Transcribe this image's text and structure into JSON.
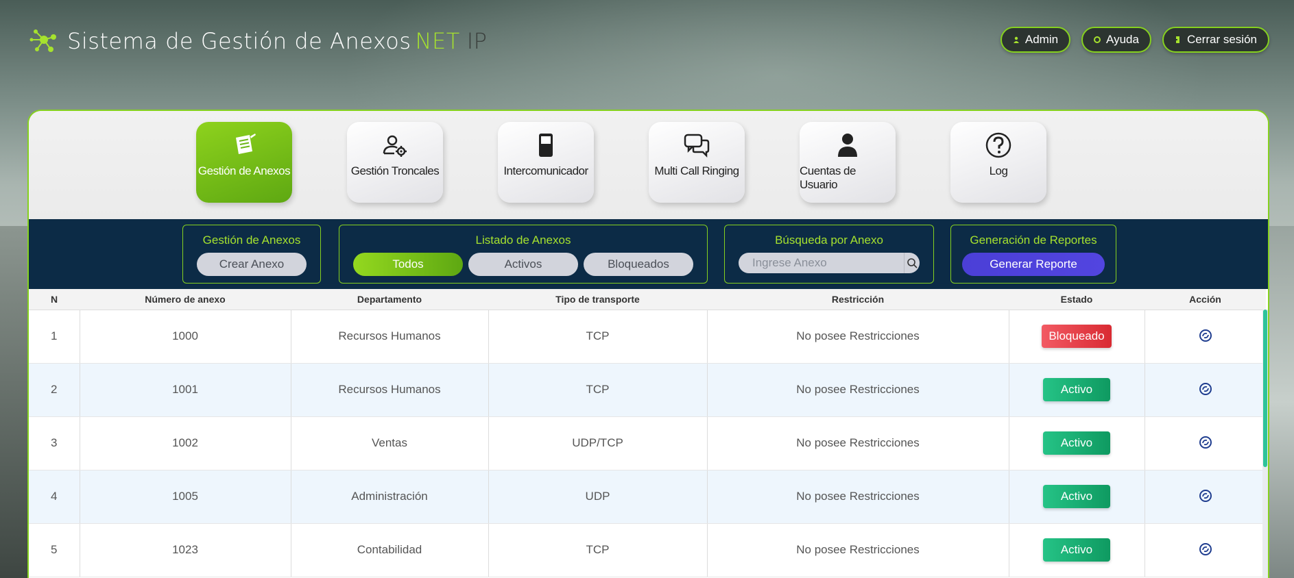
{
  "app": {
    "title": "Sistema de Gestión de Anexos",
    "title_net": "NET",
    "title_ip": "IP"
  },
  "top_actions": {
    "admin": "Admin",
    "help": "Ayuda",
    "logout": "Cerrar sesión"
  },
  "nav": {
    "items": [
      {
        "label": "Gestión de Anexos",
        "icon": "notepad-icon",
        "active": true
      },
      {
        "label": "Gestión Troncales",
        "icon": "user-gear-icon",
        "active": false
      },
      {
        "label": "Intercomunicador",
        "icon": "intercom-icon",
        "active": false
      },
      {
        "label": "Multi Call Ringing",
        "icon": "chat-bubbles-icon",
        "active": false
      },
      {
        "label": "Cuentas de Usuario",
        "icon": "user-icon",
        "active": false
      },
      {
        "label": "Log",
        "icon": "question-circle-icon",
        "active": false
      }
    ]
  },
  "toolbar": {
    "gestion": {
      "title": "Gestión de Anexos",
      "create_label": "Crear Anexo"
    },
    "listado": {
      "title": "Listado de Anexos",
      "filters": [
        "Todos",
        "Activos",
        "Bloqueados"
      ],
      "selected": "Todos"
    },
    "busqueda": {
      "title": "Búsqueda por Anexo",
      "placeholder": "Ingrese Anexo",
      "value": ""
    },
    "reportes": {
      "title": "Generación de Reportes",
      "button_label": "Generar Reporte"
    }
  },
  "table": {
    "columns": [
      "N",
      "Número de anexo",
      "Departamento",
      "Tipo de transporte",
      "Restricción",
      "Estado",
      "Acción"
    ],
    "rows": [
      {
        "n": "1",
        "number": "1000",
        "department": "Recursos Humanos",
        "transport": "TCP",
        "restriction": "No posee Restricciones",
        "status": "Bloqueado"
      },
      {
        "n": "2",
        "number": "1001",
        "department": "Recursos Humanos",
        "transport": "TCP",
        "restriction": "No posee Restricciones",
        "status": "Activo"
      },
      {
        "n": "3",
        "number": "1002",
        "department": "Ventas",
        "transport": "UDP/TCP",
        "restriction": "No posee Restricciones",
        "status": "Activo"
      },
      {
        "n": "4",
        "number": "1005",
        "department": "Administración",
        "transport": "UDP",
        "restriction": "No posee Restricciones",
        "status": "Activo"
      },
      {
        "n": "5",
        "number": "1023",
        "department": "Contabilidad",
        "transport": "TCP",
        "restriction": "No posee Restricciones",
        "status": "Activo"
      }
    ]
  },
  "colors": {
    "accent_green": "#86d11f",
    "toolbar_bg": "#0c2b46",
    "blocked": "#d92a32",
    "active": "#0f9a61",
    "report_blue": "#4b3fd7"
  }
}
